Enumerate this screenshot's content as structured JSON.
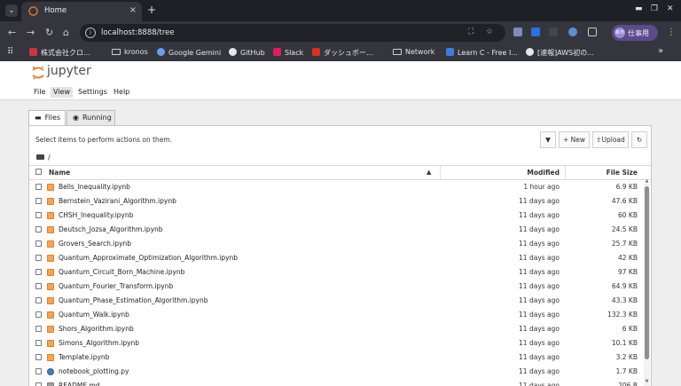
{
  "browser": {
    "tab_title": "Home",
    "url": "localhost:8888/tree",
    "profile_label": "仕事用",
    "profile_initials": "新市",
    "bookmarks": [
      {
        "label": "株式会社クロ...",
        "icon": "corporate-bookmark-icon"
      },
      {
        "label": "kronos",
        "icon": "folder-icon"
      },
      {
        "label": "Google Gemini",
        "icon": "gemini-icon"
      },
      {
        "label": "GitHub",
        "icon": "github-icon"
      },
      {
        "label": "Slack",
        "icon": "slack-icon"
      },
      {
        "label": "ダッシュボー...",
        "icon": "dashboard-bookmark-icon"
      },
      {
        "label": "Network",
        "icon": "folder-icon"
      },
      {
        "label": "Learn C - Free I...",
        "icon": "learn-c-icon"
      },
      {
        "label": "[速報]AWS初の...",
        "icon": "news-bookmark-icon"
      }
    ]
  },
  "jupyter": {
    "logo_text": "jupyter",
    "menu": [
      "File",
      "View",
      "Settings",
      "Help"
    ],
    "active_menu": "View",
    "tabs": [
      {
        "label": "Files",
        "icon": "folder-icon"
      },
      {
        "label": "Running",
        "icon": "running-icon"
      }
    ],
    "hint": "Select items to perform actions on them.",
    "toolbar": {
      "new_label": "New",
      "upload_label": "Upload"
    },
    "breadcrumb": "/",
    "columns": {
      "name": "Name",
      "modified": "Modified",
      "size": "File Size"
    },
    "files": [
      {
        "name": "Bells_Inequality.ipynb",
        "modified": "1 hour ago",
        "size": "6.9 KB",
        "kind": "notebook"
      },
      {
        "name": "Bernstein_Vazirani_Algorithm.ipynb",
        "modified": "11 days ago",
        "size": "47.6 KB",
        "kind": "notebook"
      },
      {
        "name": "CHSH_Inequality.ipynb",
        "modified": "11 days ago",
        "size": "60 KB",
        "kind": "notebook"
      },
      {
        "name": "Deutsch_Jozsa_Algorithm.ipynb",
        "modified": "11 days ago",
        "size": "24.5 KB",
        "kind": "notebook"
      },
      {
        "name": "Grovers_Search.ipynb",
        "modified": "11 days ago",
        "size": "25.7 KB",
        "kind": "notebook"
      },
      {
        "name": "Quantum_Approximate_Optimization_Algorithm.ipynb",
        "modified": "11 days ago",
        "size": "42 KB",
        "kind": "notebook"
      },
      {
        "name": "Quantum_Circuit_Born_Machine.ipynb",
        "modified": "11 days ago",
        "size": "97 KB",
        "kind": "notebook"
      },
      {
        "name": "Quantum_Fourier_Transform.ipynb",
        "modified": "11 days ago",
        "size": "64.9 KB",
        "kind": "notebook"
      },
      {
        "name": "Quantum_Phase_Estimation_Algorithm.ipynb",
        "modified": "11 days ago",
        "size": "43.3 KB",
        "kind": "notebook"
      },
      {
        "name": "Quantum_Walk.ipynb",
        "modified": "11 days ago",
        "size": "132.3 KB",
        "kind": "notebook"
      },
      {
        "name": "Shors_Algorithm.ipynb",
        "modified": "11 days ago",
        "size": "6 KB",
        "kind": "notebook"
      },
      {
        "name": "Simons_Algorithm.ipynb",
        "modified": "11 days ago",
        "size": "10.1 KB",
        "kind": "notebook"
      },
      {
        "name": "Template.ipynb",
        "modified": "11 days ago",
        "size": "3.2 KB",
        "kind": "notebook"
      },
      {
        "name": "notebook_plotting.py",
        "modified": "11 days ago",
        "size": "1.7 KB",
        "kind": "python"
      },
      {
        "name": "README.md",
        "modified": "11 days ago",
        "size": "206 B",
        "kind": "markdown"
      }
    ]
  }
}
